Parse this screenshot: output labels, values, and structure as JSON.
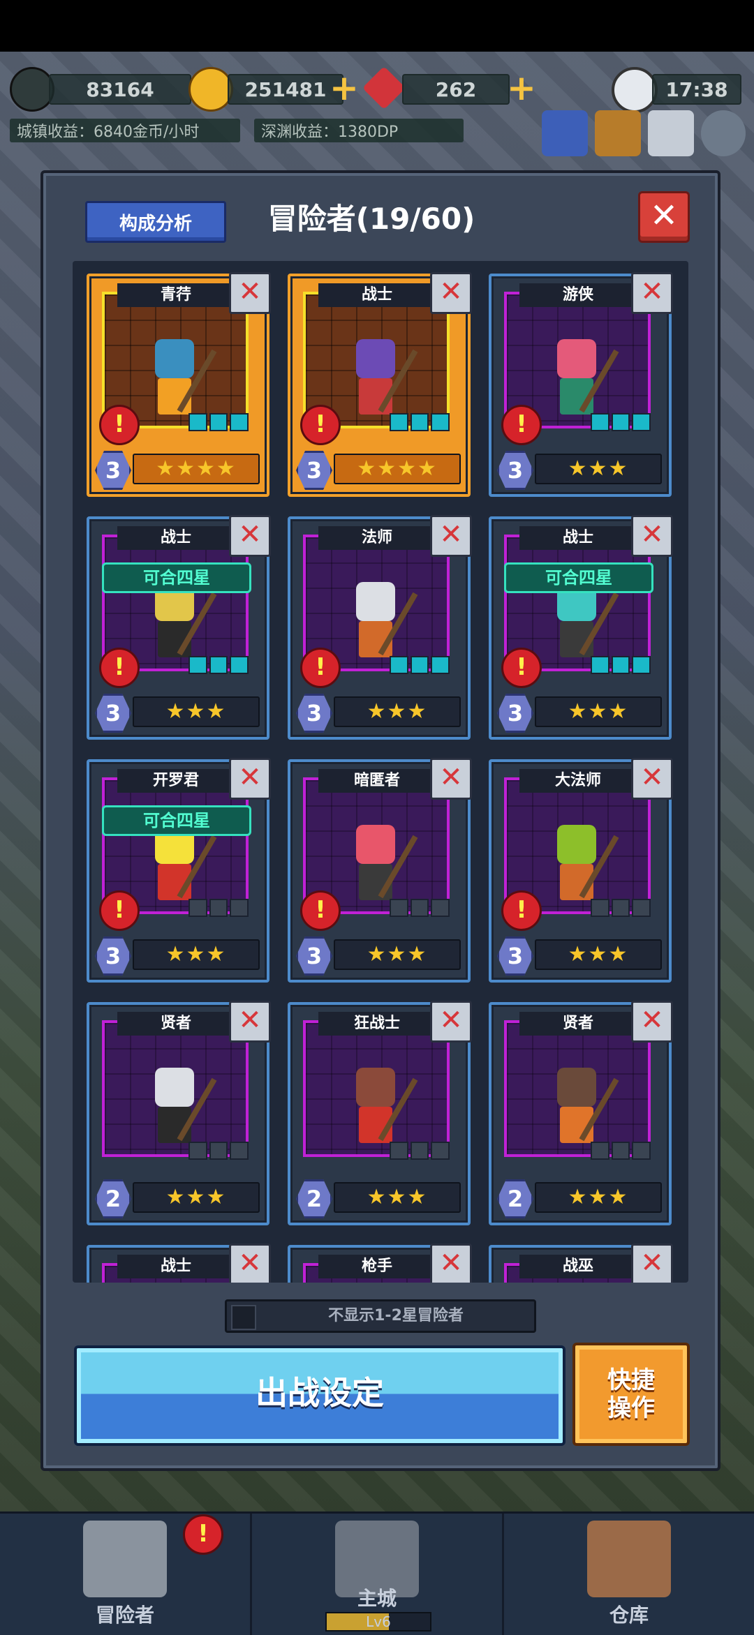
{
  "hud": {
    "power": "83164",
    "gold": "251481",
    "gems": "262",
    "time": "17:38",
    "town_income": "城镇收益：6840金币/小时",
    "abyss_income": "深渊收益：1380DP",
    "icons": [
      "wrench-moon-icon",
      "gold-coin-icon",
      "red-gem-icon",
      "clock-icon",
      "party-icon",
      "chest-icon",
      "compass-icon",
      "gear-icon"
    ]
  },
  "modal": {
    "analysis_label": "构成分析",
    "title": "冒险者(19/60)",
    "close_label": "✕",
    "filter_label": "不显示1-2星冒险者",
    "deploy_label": "出战设定",
    "quick_label_line1": "快捷",
    "quick_label_line2": "操作"
  },
  "cards": [
    {
      "name": "青荇",
      "level": "3",
      "stars": "★★★★",
      "combine": "",
      "alert": "!",
      "gold": true
    },
    {
      "name": "战士",
      "level": "3",
      "stars": "★★★★",
      "combine": "",
      "alert": "!",
      "gold": true
    },
    {
      "name": "游侠",
      "level": "3",
      "stars": "★★★",
      "combine": "",
      "alert": "!",
      "gold": false
    },
    {
      "name": "战士",
      "level": "3",
      "stars": "★★★",
      "combine": "可合四星",
      "alert": "!",
      "gold": false
    },
    {
      "name": "法师",
      "level": "3",
      "stars": "★★★",
      "combine": "",
      "alert": "!",
      "gold": false
    },
    {
      "name": "战士",
      "level": "3",
      "stars": "★★★",
      "combine": "可合四星",
      "alert": "!",
      "gold": false
    },
    {
      "name": "开罗君",
      "level": "3",
      "stars": "★★★",
      "combine": "可合四星",
      "alert": "!",
      "gold": false
    },
    {
      "name": "暗匿者",
      "level": "3",
      "stars": "★★★",
      "combine": "",
      "alert": "!",
      "gold": false
    },
    {
      "name": "大法师",
      "level": "3",
      "stars": "★★★",
      "combine": "",
      "alert": "!",
      "gold": false
    },
    {
      "name": "贤者",
      "level": "2",
      "stars": "★★★",
      "combine": "",
      "alert": "",
      "gold": false
    },
    {
      "name": "狂战士",
      "level": "2",
      "stars": "★★★",
      "combine": "",
      "alert": "",
      "gold": false
    },
    {
      "name": "贤者",
      "level": "2",
      "stars": "★★★",
      "combine": "",
      "alert": "",
      "gold": false
    },
    {
      "name": "战士",
      "level": "",
      "stars": "",
      "combine": "",
      "alert": "",
      "gold": false
    },
    {
      "name": "枪手",
      "level": "",
      "stars": "",
      "combine": "",
      "alert": "",
      "gold": false
    },
    {
      "name": "战巫",
      "level": "",
      "stars": "",
      "combine": "",
      "alert": "",
      "gold": false
    }
  ],
  "bottom_nav": {
    "adventurer": "冒险者",
    "main_city": "主城",
    "warehouse": "仓库",
    "level": "Lv6",
    "badge": "!"
  },
  "colors": {
    "card_border_normal": "#4d8bcb",
    "card_border_gold": "#f2a02a",
    "combine_text": "#53ffd2",
    "accent_blue": "#3e63c2",
    "accent_orange": "#f29a2e"
  }
}
